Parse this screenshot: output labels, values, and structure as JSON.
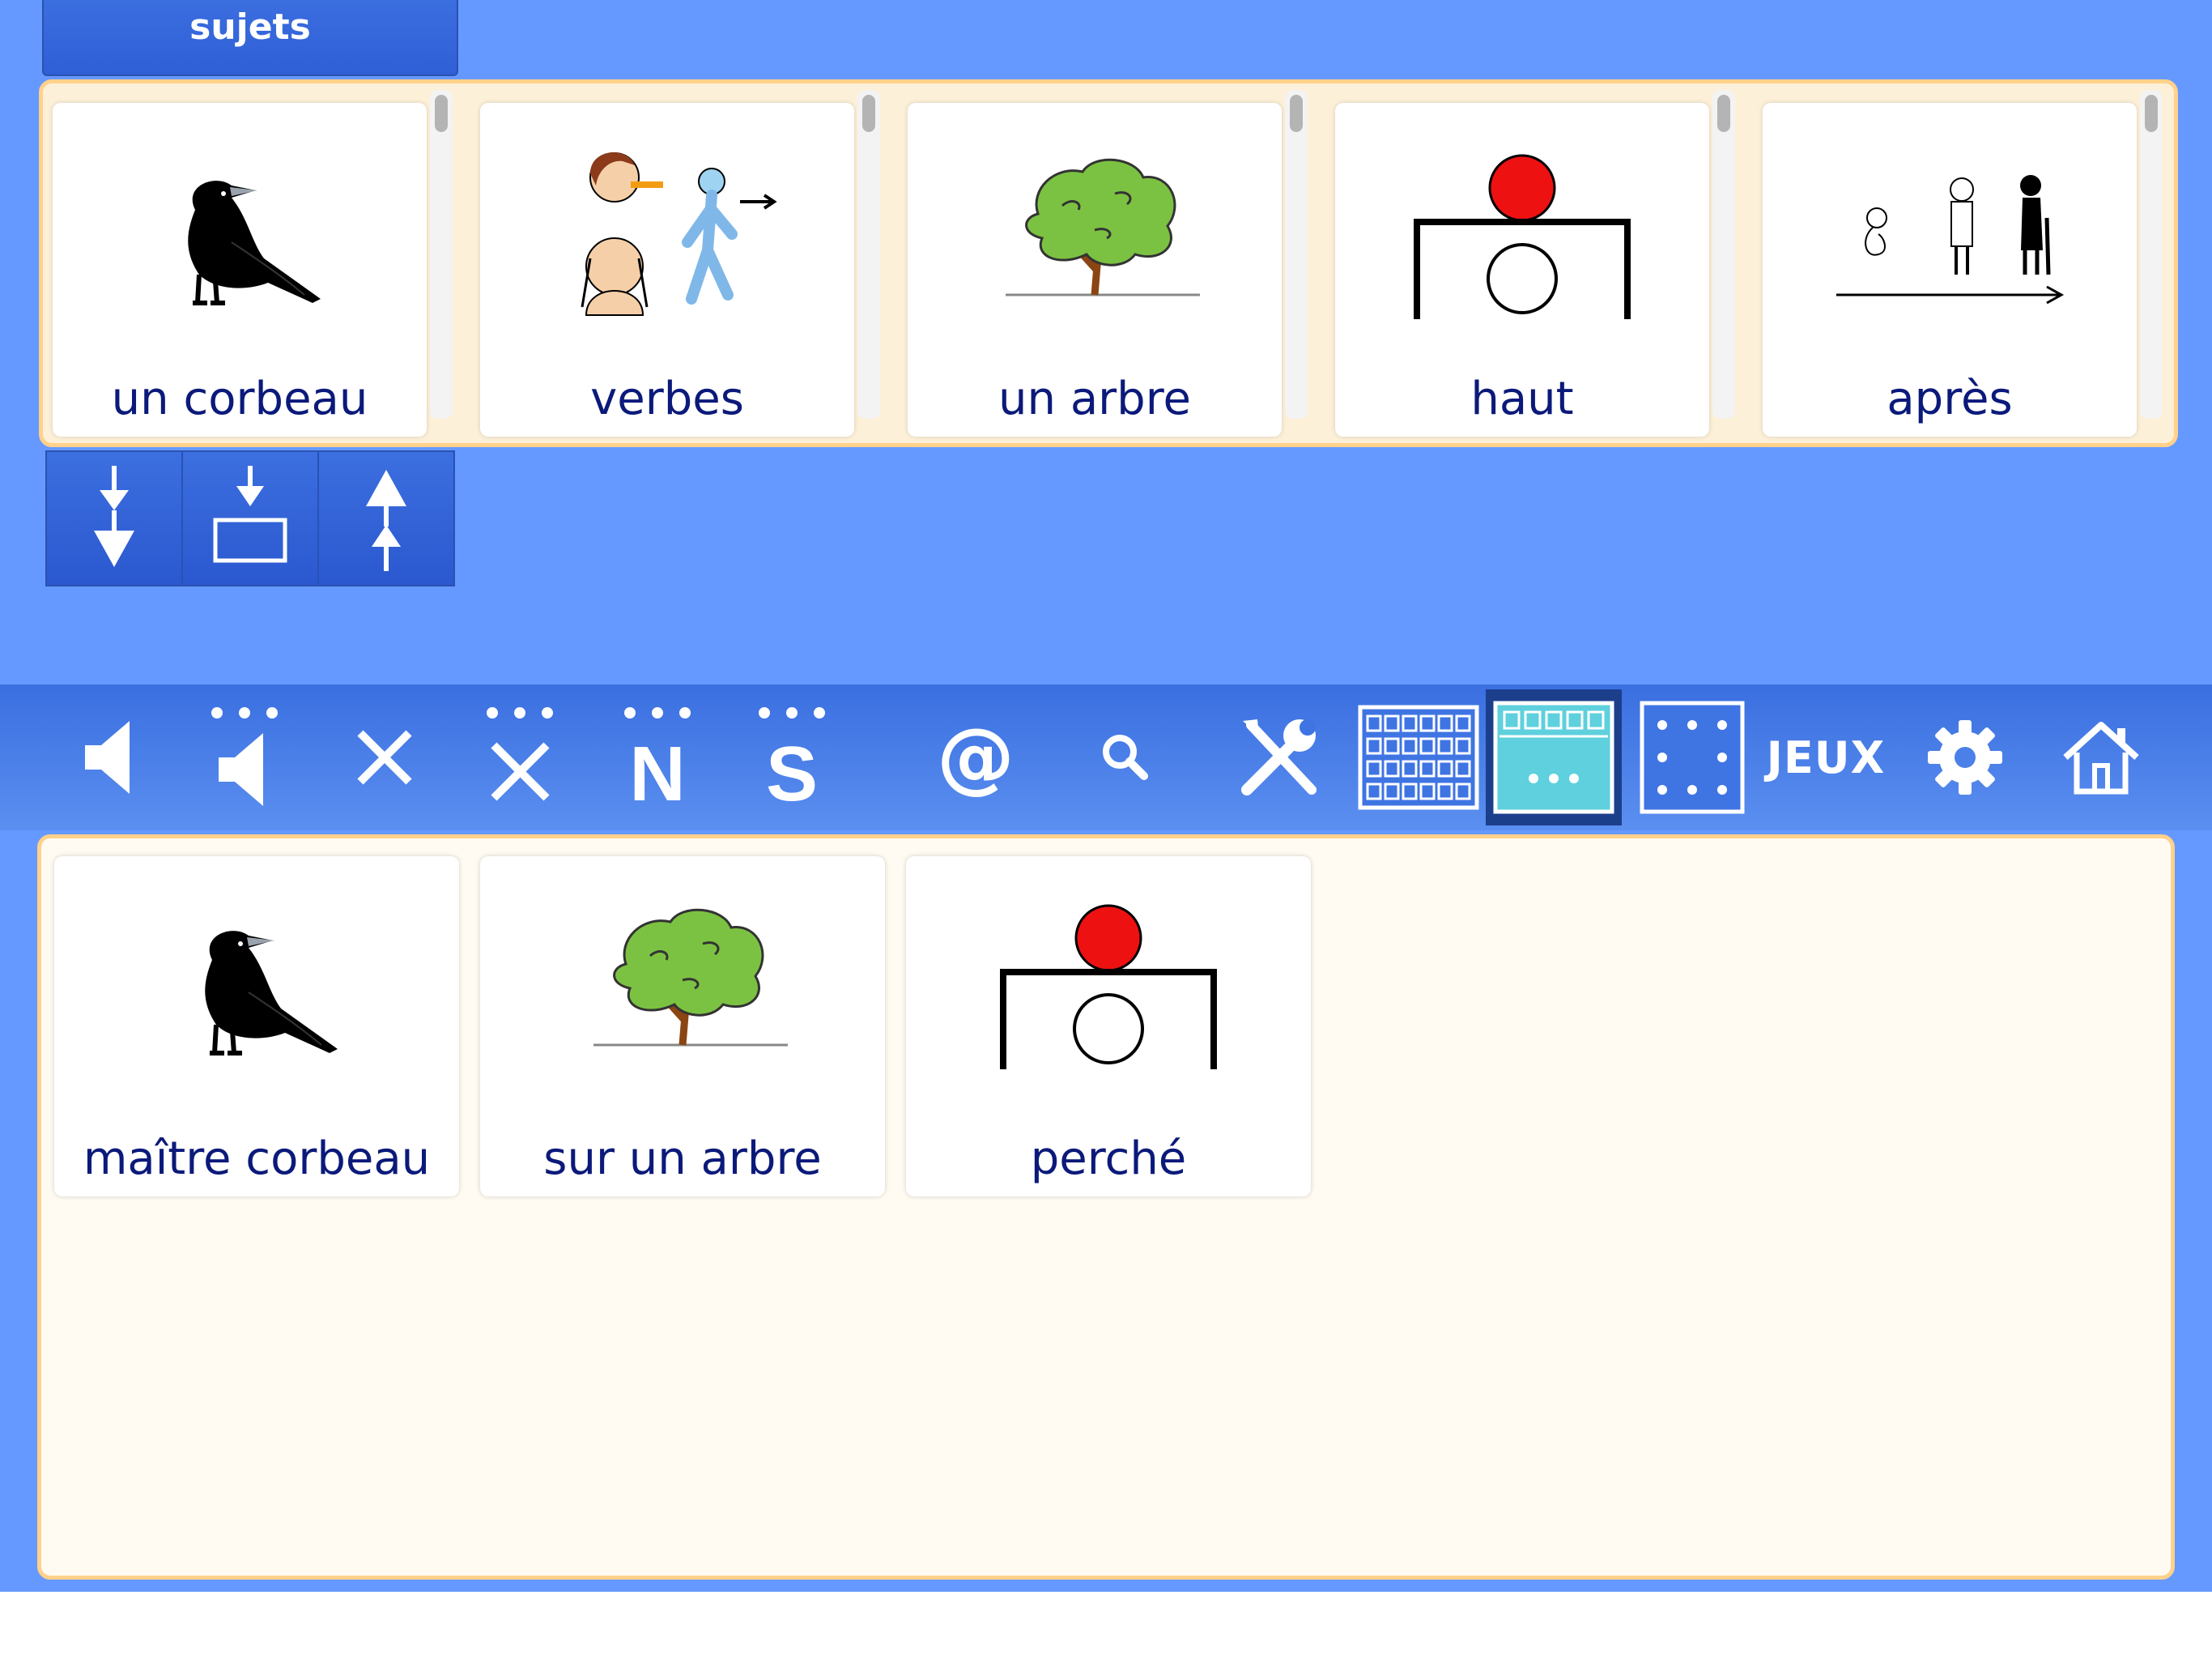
{
  "tab": {
    "label": "sujets"
  },
  "topStrip": {
    "cards": [
      {
        "label": "un corbeau",
        "icon": "crow-icon"
      },
      {
        "label": "verbes",
        "icon": "verbs-icon"
      },
      {
        "label": "un arbre",
        "icon": "tree-icon"
      },
      {
        "label": "haut",
        "icon": "up-position-icon"
      },
      {
        "label": "après",
        "icon": "after-timeline-icon"
      }
    ]
  },
  "moveButtons": [
    "move-down-icon",
    "insert-down-icon",
    "move-up-icon"
  ],
  "toolbar": {
    "items": [
      "speak-icon",
      "speak-all-icon",
      "delete-icon",
      "delete-all-icon",
      "n-dots-icon",
      "s-dots-icon",
      "at-icon",
      "search-icon",
      "tools-icon",
      "grid-large-icon",
      "grid-strip-icon",
      "grid-dots-icon",
      "games",
      "gear-icon",
      "home-icon"
    ],
    "games_label": "JEUX",
    "selected": "grid-strip-icon"
  },
  "message": {
    "cards": [
      {
        "label": "maître corbeau",
        "icon": "crow-icon"
      },
      {
        "label": "sur un arbre",
        "icon": "tree-icon"
      },
      {
        "label": "perché",
        "icon": "up-position-icon"
      }
    ]
  },
  "colors": {
    "background": "#6699ff",
    "toolbar": "#3a6fe0",
    "strip": "#fdf0d8",
    "stripBorder": "#ffd18a",
    "labelText": "#0b1a7a",
    "selectedTool": "#5fd0dd"
  }
}
